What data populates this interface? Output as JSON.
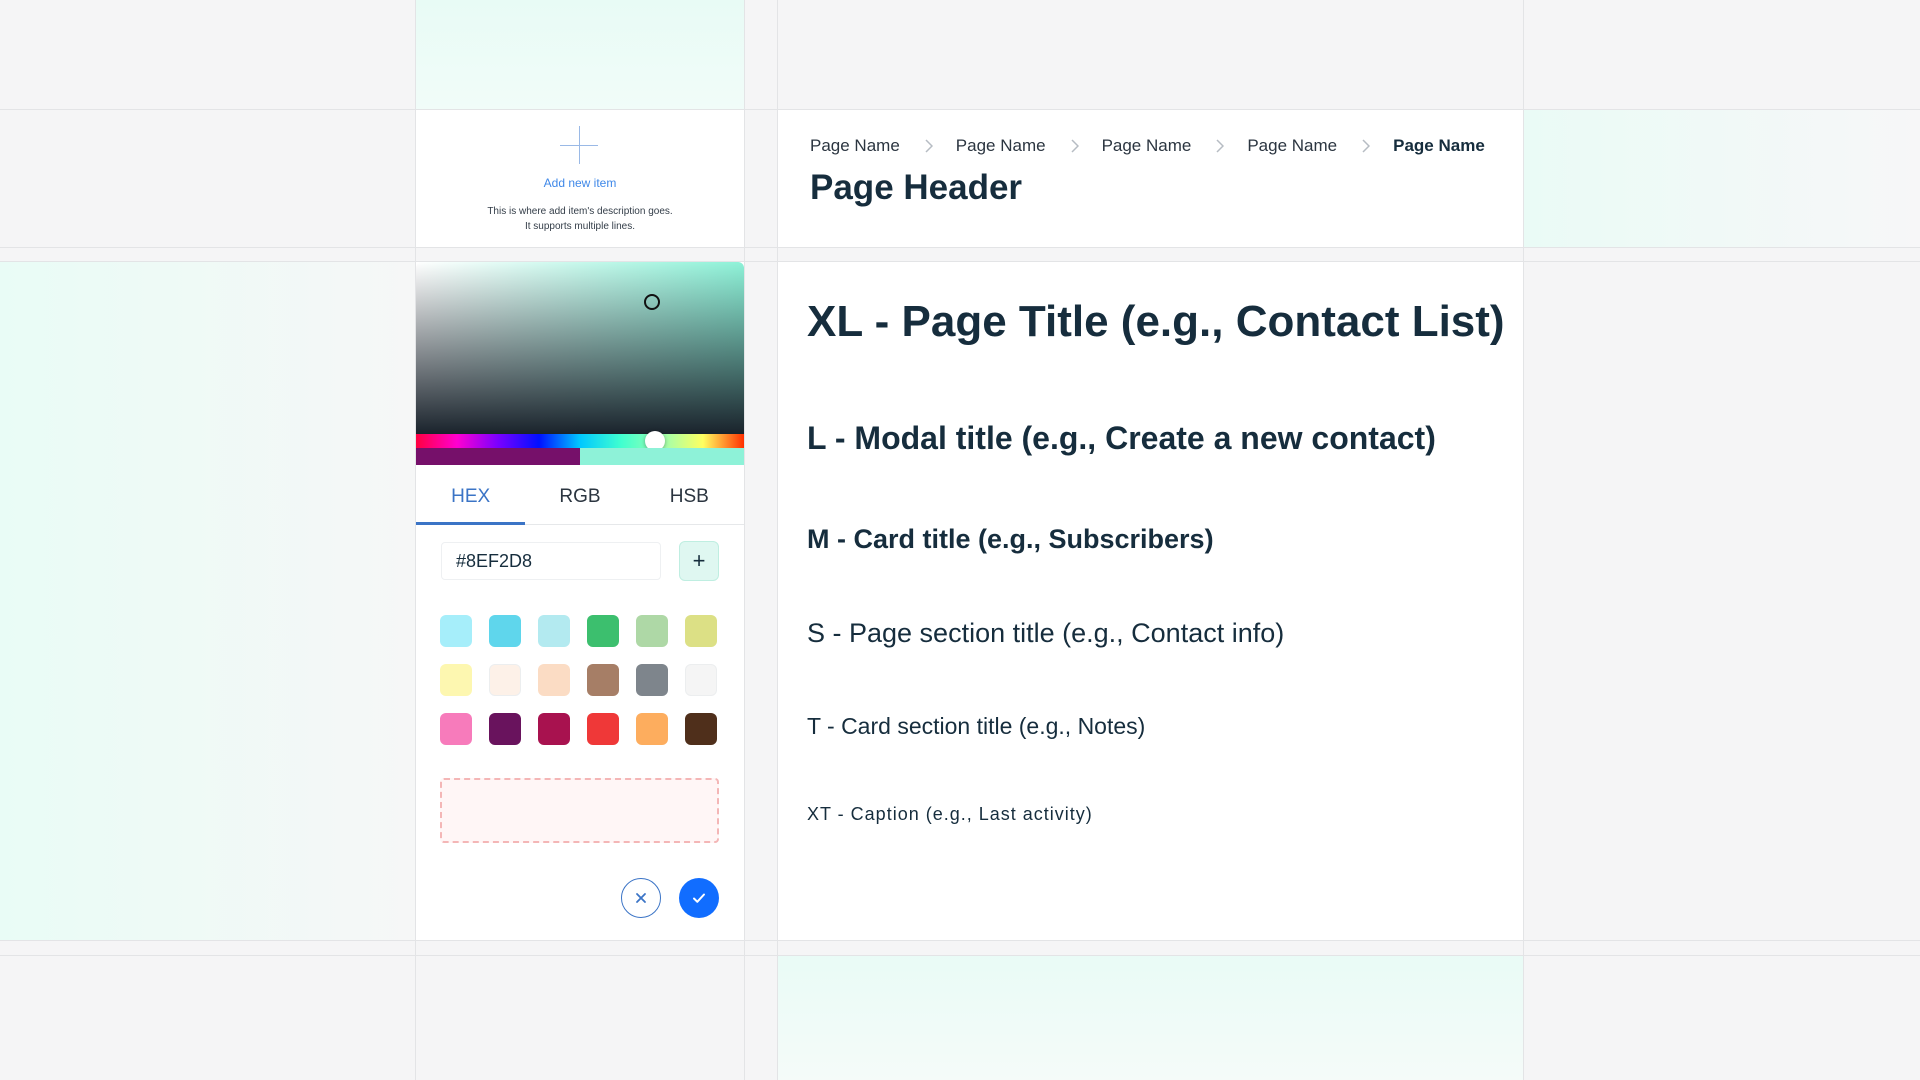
{
  "add_item": {
    "label": "Add new item",
    "description_line1": "This is where add item's description goes.",
    "description_line2": "It supports multiple lines."
  },
  "breadcrumb": {
    "items": [
      "Page Name",
      "Page Name",
      "Page Name",
      "Page Name",
      "Page Name"
    ]
  },
  "page_header": "Page Header",
  "color_picker": {
    "tabs": [
      "HEX",
      "RGB",
      "HSB"
    ],
    "active_tab": "HEX",
    "hex_value": "#8EF2D8",
    "add_symbol": "+",
    "previous_color": "#76106A",
    "current_color": "#8EF2D8",
    "swatches": [
      "#A6EEFA",
      "#5FD6EC",
      "#B3EAF0",
      "#3CBF6E",
      "#AED8A6",
      "#DCE085",
      "#FDF7B0",
      "#FDF1E8",
      "#FBDCC4",
      "#A67E66",
      "#7E858C",
      "#F5F5F5",
      "#F77BBB",
      "#69135D",
      "#A8124F",
      "#EF3838",
      "#FDAD5E",
      "#4F2F1B"
    ]
  },
  "typography": {
    "xl": "XL - Page Title (e.g., Contact List)",
    "l": "L - Modal title (e.g., Create a new contact)",
    "m": "M - Card title (e.g., Subscribers)",
    "s": "S - Page section title (e.g., Contact info)",
    "t": "T - Card section title (e.g., Notes)",
    "xt": "XT - Caption (e.g., Last activity)"
  },
  "colors": {
    "accent": "#116DFF",
    "tab_active": "#3B74C6",
    "text": "#162D3D",
    "mint_tint": "#EAFBF6"
  }
}
